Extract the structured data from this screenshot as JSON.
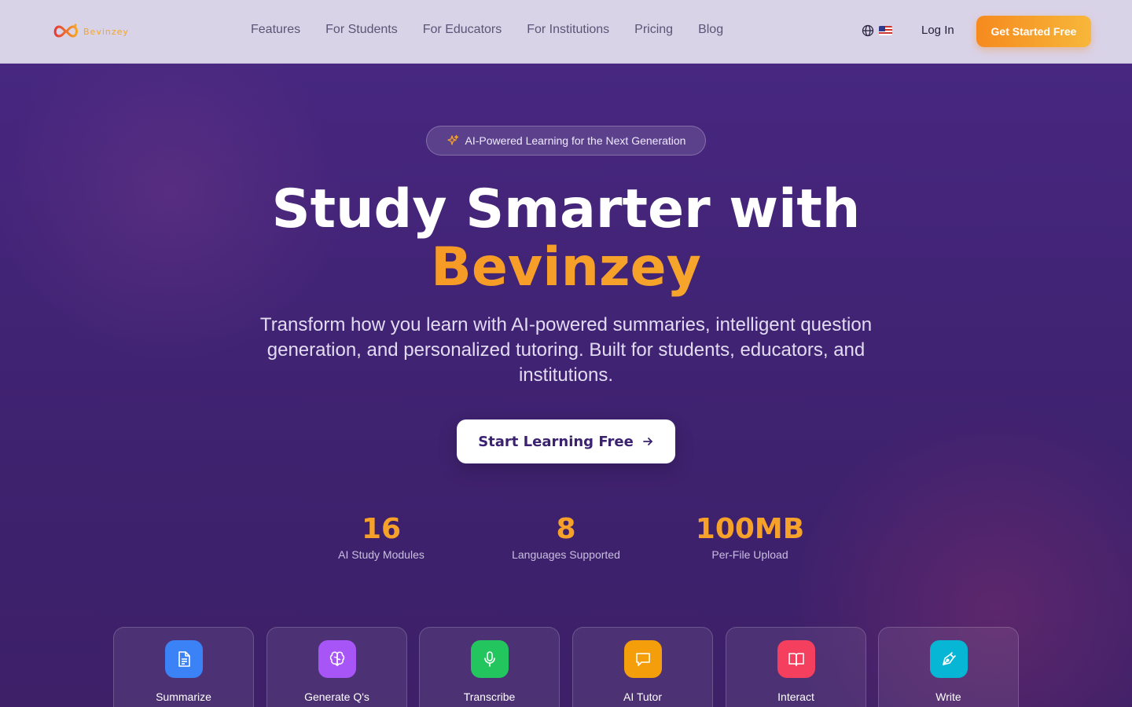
{
  "brand": {
    "name": "Bevinzey",
    "accent": "#f68a1f",
    "accent2": "#f7b73a"
  },
  "header": {
    "nav": [
      "Features",
      "For Students",
      "For Educators",
      "For Institutions",
      "Pricing",
      "Blog"
    ],
    "language_icon": "globe-icon",
    "flag": "us-flag-icon",
    "login_label": "Log In",
    "cta_label": "Get Started Free"
  },
  "hero": {
    "badge": "AI-Powered Learning for the Next Generation",
    "title_line1": "Study Smarter with",
    "title_line2": "Bevinzey",
    "subtitle": "Transform how you learn with AI-powered summaries, intelligent question generation, and personalized tutoring. Built for students, educators, and institutions.",
    "cta_label": "Start Learning Free"
  },
  "stats": [
    {
      "value": "16",
      "label": "AI Study Modules"
    },
    {
      "value": "8",
      "label": "Languages Supported"
    },
    {
      "value": "100MB",
      "label": "Per-File Upload"
    }
  ],
  "modules": [
    {
      "label": "Summarize",
      "icon": "document-icon",
      "color": "#3b82f6"
    },
    {
      "label": "Generate Q's",
      "icon": "brain-icon",
      "color": "#a855f7"
    },
    {
      "label": "Transcribe",
      "icon": "microphone-icon",
      "color": "#22c55e"
    },
    {
      "label": "AI Tutor",
      "icon": "chat-bubble-icon",
      "color": "#f59e0b"
    },
    {
      "label": "Interact",
      "icon": "open-book-icon",
      "color": "#f43f5e"
    },
    {
      "label": "Write",
      "icon": "pen-tool-icon",
      "color": "#06b6d4"
    }
  ]
}
